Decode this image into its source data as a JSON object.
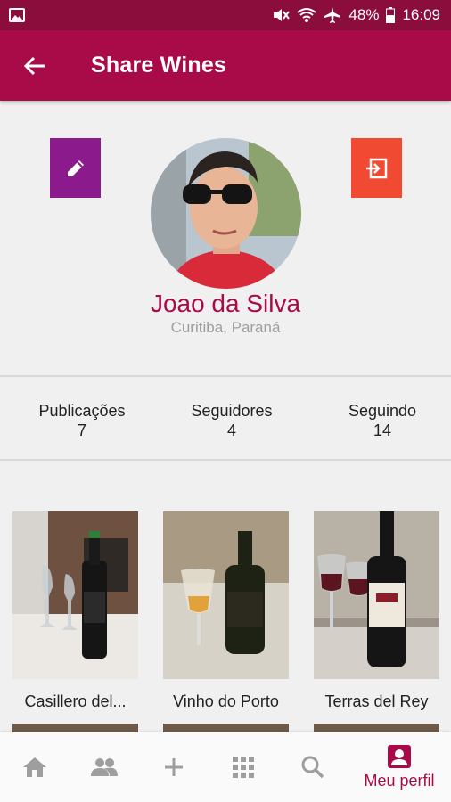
{
  "status_bar": {
    "battery": "48%",
    "time": "16:09"
  },
  "app_bar": {
    "title": "Share Wines"
  },
  "profile": {
    "name": "Joao da Silva",
    "location": "Curitiba, Paraná"
  },
  "stats": [
    {
      "label": "Publicações",
      "value": "7"
    },
    {
      "label": "Seguidores",
      "value": "4"
    },
    {
      "label": "Seguindo",
      "value": "14"
    }
  ],
  "posts": [
    {
      "title": "Casillero del..."
    },
    {
      "title": "Vinho do Porto"
    },
    {
      "title": "Terras del Rey"
    }
  ],
  "bottom_nav": {
    "active_label": "Meu perfil"
  },
  "colors": {
    "primary": "#a80b47",
    "status": "#8a0d3c",
    "edit": "#8b1b8d",
    "logout": "#f14a33"
  }
}
